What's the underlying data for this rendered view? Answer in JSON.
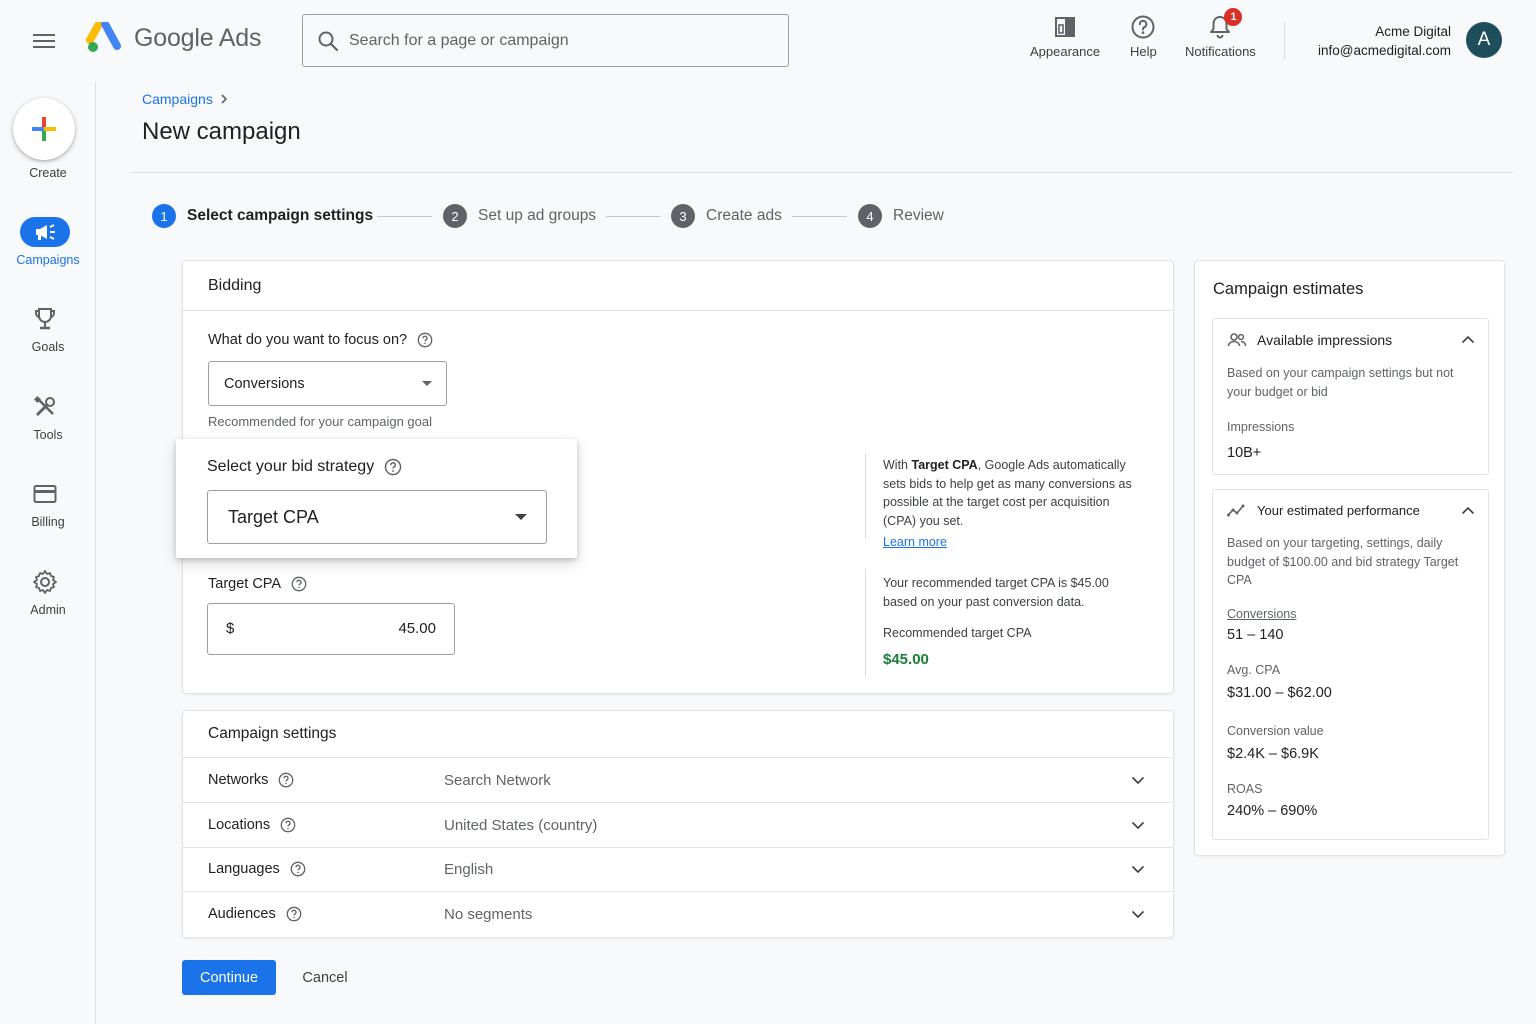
{
  "app": {
    "name": "Google Ads"
  },
  "search": {
    "placeholder": "Search for a page or campaign"
  },
  "topbar": {
    "appearance": "Appearance",
    "help": "Help",
    "notifications": "Notifications",
    "notification_count": "1",
    "account_name": "Acme Digital",
    "account_email": "info@acmedigital.com",
    "avatar_letter": "A"
  },
  "nav": {
    "create": "Create",
    "campaigns": "Campaigns",
    "goals": "Goals",
    "tools": "Tools",
    "billing": "Billing",
    "admin": "Admin"
  },
  "breadcrumb": {
    "parent": "Campaigns"
  },
  "page_title": "New campaign",
  "steps": [
    {
      "num": "1",
      "label": "Select campaign settings"
    },
    {
      "num": "2",
      "label": "Set up ad groups"
    },
    {
      "num": "3",
      "label": "Create ads"
    },
    {
      "num": "4",
      "label": "Review"
    }
  ],
  "bidding": {
    "title": "Bidding",
    "focus_question": "What do you want to focus on?",
    "focus_value": "Conversions",
    "focus_hint": "Recommended for your campaign goal",
    "strategy_label": "Select your bid strategy",
    "strategy_value": "Target CPA",
    "target_cpa_label": "Target CPA",
    "currency": "$",
    "target_cpa_value": "45.00",
    "info_prefix": "With ",
    "info_bold": "Target CPA",
    "info_rest": ", Google Ads automatically sets bids to help get as many conversions as possible at the target cost per acquisition (CPA) you set.",
    "learn_more": "Learn more",
    "recommend_text": "Your recommended target CPA is $45.00 based on your past conversion data.",
    "recommended_label": "Recommended target CPA",
    "recommended_value": "$45.00"
  },
  "settings": {
    "title": "Campaign settings",
    "rows": [
      {
        "name": "Networks",
        "value": "Search Network"
      },
      {
        "name": "Locations",
        "value": "United States (country)"
      },
      {
        "name": "Languages",
        "value": "English"
      },
      {
        "name": "Audiences",
        "value": "No segments"
      }
    ]
  },
  "actions": {
    "continue": "Continue",
    "cancel": "Cancel"
  },
  "estimates": {
    "title": "Campaign estimates",
    "impressions": {
      "title": "Available impressions",
      "desc": "Based on your campaign settings but not your budget or bid",
      "label": "Impressions",
      "value": "10B+"
    },
    "performance": {
      "title": "Your estimated performance",
      "desc": "Based on your targeting, settings, daily budget of $100.00 and bid strategy Target CPA",
      "conversions_label": "Conversions",
      "conversions_value": "51 – 140",
      "cpa_label": "Avg. CPA",
      "cpa_value": "$31.00 – $62.00",
      "value_label": "Conversion value",
      "value_value": "$2.4K – $6.9K",
      "roas_label": "ROAS",
      "roas_value": "240% – 690%"
    }
  },
  "colors": {
    "primary": "#1a73e8",
    "success": "#188038",
    "alert": "#d93025",
    "avatar": "#1e4d5c"
  }
}
